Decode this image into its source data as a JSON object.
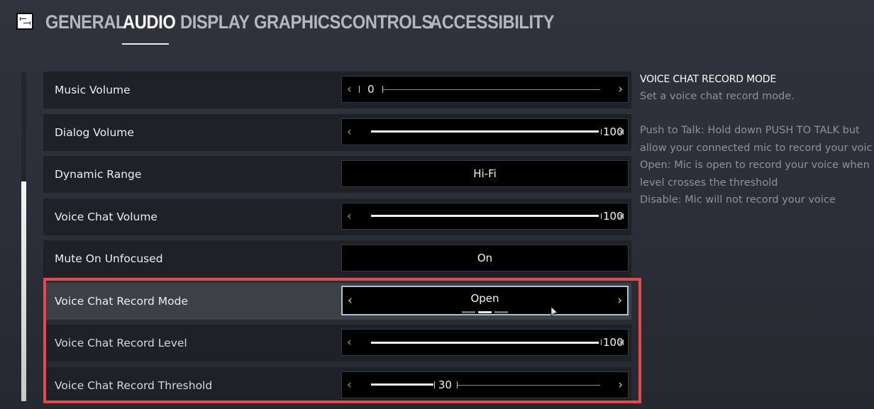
{
  "nav": {
    "menu_icon": "settings-menu-icon",
    "tabs": [
      {
        "label": "GENERAL",
        "active": false
      },
      {
        "label": "AUDIO",
        "active": true
      },
      {
        "label": "DISPLAY",
        "active": false
      },
      {
        "label": "GRAPHICS",
        "active": false
      },
      {
        "label": "CONTROLS",
        "active": false
      },
      {
        "label": "ACCESSIBILITY",
        "active": false
      }
    ]
  },
  "settings": [
    {
      "label": "Music Volume",
      "type": "slider",
      "value": "0",
      "percent": 0
    },
    {
      "label": "Dialog Volume",
      "type": "slider",
      "value": "100",
      "percent": 100
    },
    {
      "label": "Dynamic Range",
      "type": "toggle",
      "value": "Hi-Fi"
    },
    {
      "label": "Voice Chat Volume",
      "type": "slider",
      "value": "100",
      "percent": 100
    },
    {
      "label": "Mute On Unfocused",
      "type": "toggle",
      "value": "On"
    },
    {
      "label": "Voice Chat Record Mode",
      "type": "selector",
      "value": "Open",
      "option_count": 3,
      "selected_index": 1
    },
    {
      "label": "Voice Chat Record Level",
      "type": "slider",
      "value": "100",
      "percent": 100
    },
    {
      "label": "Voice Chat Record Threshold",
      "type": "slider",
      "value": "30",
      "percent": 30
    }
  ],
  "icons": {
    "left": "‹",
    "right": "›"
  },
  "description": {
    "title": "VOICE CHAT RECORD MODE",
    "subtitle": "Set a voice chat record mode.",
    "lines": [
      "Push to Talk: Hold down PUSH TO TALK but",
      "allow your connected mic to record your voic",
      "Open: Mic is open to record your voice when",
      "level crosses the threshold",
      "Disable: Mic will not record your voice"
    ]
  },
  "colors": {
    "highlight": "#e5484d",
    "background": "#2d2f39",
    "row": "#1f2128",
    "row_selected": "#3e4048"
  }
}
